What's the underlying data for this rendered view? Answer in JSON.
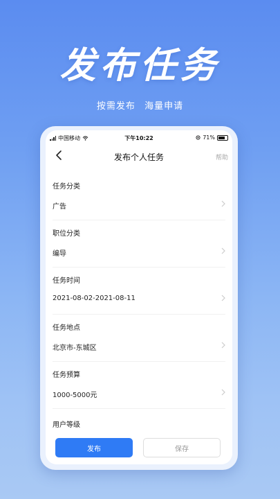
{
  "hero": {
    "title": "发布任务",
    "subtitle_left": "按需发布",
    "subtitle_right": "海量申请"
  },
  "status_bar": {
    "carrier": "中国移动",
    "time": "下午10:22",
    "battery": "71%"
  },
  "nav": {
    "title": "发布个人任务",
    "help": "帮助"
  },
  "fields": [
    {
      "label": "任务分类",
      "value": "广告"
    },
    {
      "label": "职位分类",
      "value": "编导"
    },
    {
      "label": "任务时间",
      "value": "2021-08-02-2021-08-11"
    },
    {
      "label": "任务地点",
      "value": "北京市-东城区"
    },
    {
      "label": "任务预算",
      "value": "1000-5000元"
    },
    {
      "label": "用户等级"
    }
  ],
  "buttons": {
    "publish": "发布",
    "save": "保存"
  },
  "colors": {
    "accent": "#2f7bf5",
    "background_top": "#5b8cf0",
    "background_bottom": "#a9c9f4"
  }
}
